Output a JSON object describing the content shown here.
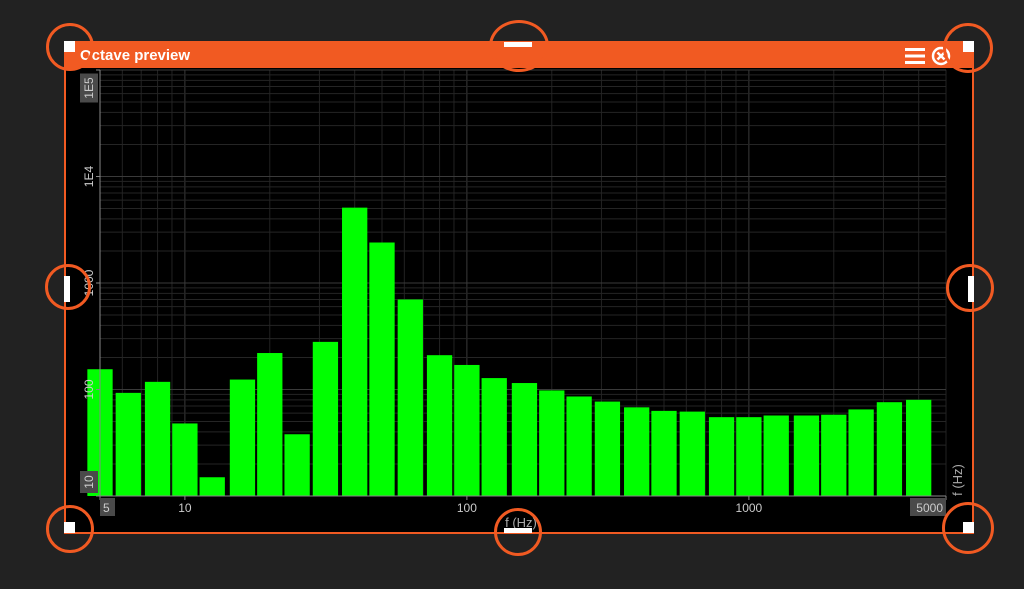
{
  "window": {
    "title": "Octave preview",
    "menu_icon": "hamburger-menu-icon",
    "close_icon": "close-circle-icon",
    "accent_color": "#f15a22"
  },
  "chart_data": {
    "type": "bar",
    "xlabel": "f (Hz)",
    "ylabel": "",
    "x_scale": "log",
    "y_scale": "log",
    "xlim": [
      5,
      5000
    ],
    "ylim": [
      10,
      100000
    ],
    "x_ticks": [
      "5",
      "10",
      "100",
      "1000",
      "5000"
    ],
    "y_ticks": [
      "10",
      "100",
      "1000",
      "1E4",
      "1E5"
    ],
    "grid": true,
    "bar_color": "#00ff00",
    "bands": [
      5,
      6.3,
      8,
      10,
      12.5,
      16,
      20,
      25,
      31.5,
      40,
      50,
      63,
      80,
      100,
      125,
      160,
      200,
      250,
      315,
      400,
      500,
      630,
      800,
      1000,
      1250,
      1600,
      2000,
      2500,
      3150,
      4000
    ],
    "values": [
      155,
      93,
      118,
      48,
      15,
      124,
      220,
      38,
      280,
      5100,
      2400,
      700,
      210,
      170,
      128,
      115,
      98,
      86,
      77,
      68,
      63,
      62,
      55,
      55,
      57,
      57,
      58,
      65,
      76,
      80
    ]
  }
}
